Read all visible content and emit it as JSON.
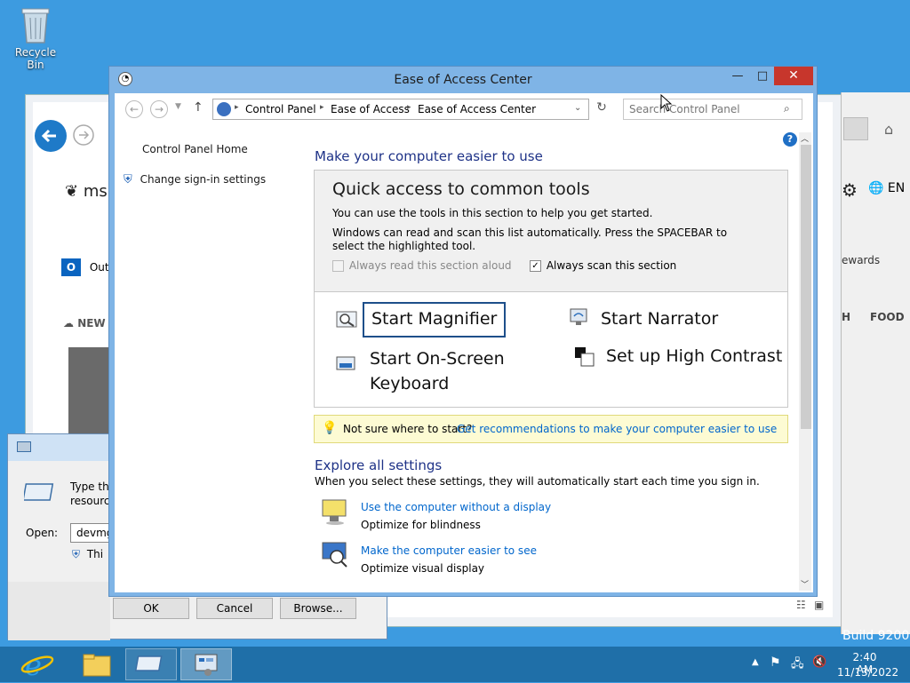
{
  "desktop": {
    "recycle_bin_label": "Recycle Bin",
    "build_label": "Build 9200"
  },
  "window": {
    "title": "Ease of Access Center",
    "breadcrumb": [
      "Control Panel",
      "Ease of Access",
      "Ease of Access Center"
    ],
    "search_placeholder": "Search Control Panel"
  },
  "left_pane": {
    "home_link": "Control Panel Home",
    "signin_link": "Change sign-in settings"
  },
  "main": {
    "heading": "Make your computer easier to use",
    "quick_title": "Quick access to common tools",
    "quick_desc1": "You can use the tools in this section to help you get started.",
    "quick_desc2": "Windows can read and scan this list automatically.  Press the SPACEBAR to select the highlighted tool.",
    "read_aloud_label": "Always read this section aloud",
    "scan_label": "Always scan this section",
    "read_aloud_checked": false,
    "scan_checked": true,
    "tools": {
      "magnifier": "Start Magnifier",
      "narrator": "Start Narrator",
      "keyboard": "Start On-Screen Keyboard",
      "contrast": "Set up High Contrast"
    },
    "tip_text": "Not sure where to start?",
    "tip_link": "Get recommendations to make your computer easier to use",
    "explore_title": "Explore all settings",
    "explore_desc": "When you select these settings, they will automatically start each time you sign in.",
    "settings": [
      {
        "link": "Use the computer without a display",
        "desc": "Optimize for blindness"
      },
      {
        "link": "Make the computer easier to see",
        "desc": "Optimize visual display"
      }
    ]
  },
  "background_ie": {
    "msn": "msn",
    "outlook": "Out",
    "news": "NEW",
    "rewards": "ewards",
    "h": "H",
    "food": "FOOD",
    "lang": "EN"
  },
  "run_dialog": {
    "desc1": "Type the",
    "desc2": "resource",
    "open_label": "Open:",
    "open_value": "devmg",
    "admin_text": "Thi",
    "ok": "OK",
    "cancel": "Cancel",
    "browse": "Browse..."
  },
  "taskbar": {
    "time": "2:40 AM",
    "date": "11/13/2022"
  }
}
